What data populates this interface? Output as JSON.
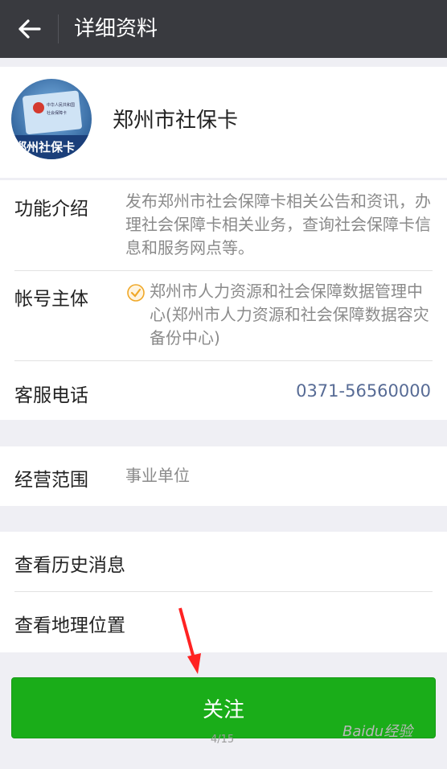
{
  "header": {
    "title": "详细资料"
  },
  "profile": {
    "name": "郑州市社保卡",
    "card_text_1": "中华人民共和国",
    "card_text_2": "社会保障卡",
    "card_caption": "郑州社保卡"
  },
  "details": [
    {
      "label": "功能介绍",
      "value": "发布郑州市社会保障卡相关公告和资讯，办理社会保障卡相关业务，查询社会保障卡信息和服务网点等。"
    },
    {
      "label": "帐号主体",
      "value": "郑州市人力资源和社会保障数据管理中心(郑州市人力资源和社会保障数据容灾备份中心)",
      "verified_icon": "verified-check-icon"
    },
    {
      "label": "客服电话",
      "value": "0371-56560000"
    }
  ],
  "scope": {
    "label": "经营范围",
    "value": "事业单位"
  },
  "links": {
    "history": "查看历史消息",
    "location": "查看地理位置"
  },
  "follow_button": "关注",
  "page_indicator": "4/15",
  "watermark": "Baidu经验",
  "colors": {
    "topbar": "#393a3f",
    "follow": "#1aad19",
    "link": "#576b95",
    "annotation_arrow": "#ff2222"
  }
}
